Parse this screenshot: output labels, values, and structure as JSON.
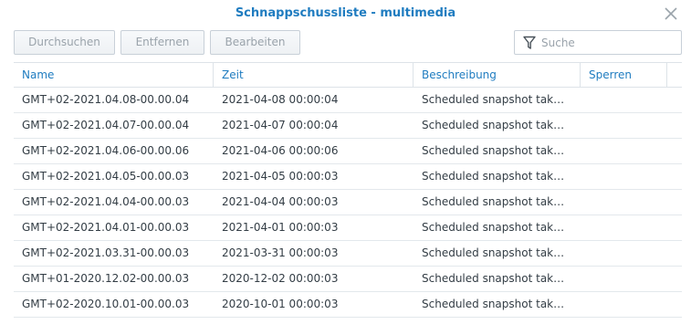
{
  "window": {
    "title": "Schnappschussliste - multimedia"
  },
  "toolbar": {
    "browse_label": "Durchsuchen",
    "remove_label": "Entfernen",
    "edit_label": "Bearbeiten",
    "search_placeholder": "Suche"
  },
  "table": {
    "columns": [
      "Name",
      "Zeit",
      "Beschreibung",
      "Sperren"
    ],
    "rows": [
      {
        "name": "GMT+02-2021.04.08-00.00.04",
        "time": "2021-04-08 00:00:04",
        "desc": "Scheduled snapshot tak…",
        "lock": ""
      },
      {
        "name": "GMT+02-2021.04.07-00.00.04",
        "time": "2021-04-07 00:00:04",
        "desc": "Scheduled snapshot tak…",
        "lock": ""
      },
      {
        "name": "GMT+02-2021.04.06-00.00.06",
        "time": "2021-04-06 00:00:06",
        "desc": "Scheduled snapshot tak…",
        "lock": ""
      },
      {
        "name": "GMT+02-2021.04.05-00.00.03",
        "time": "2021-04-05 00:00:03",
        "desc": "Scheduled snapshot tak…",
        "lock": ""
      },
      {
        "name": "GMT+02-2021.04.04-00.00.03",
        "time": "2021-04-04 00:00:03",
        "desc": "Scheduled snapshot tak…",
        "lock": ""
      },
      {
        "name": "GMT+02-2021.04.01-00.00.03",
        "time": "2021-04-01 00:00:03",
        "desc": "Scheduled snapshot tak…",
        "lock": ""
      },
      {
        "name": "GMT+02-2021.03.31-00.00.03",
        "time": "2021-03-31 00:00:03",
        "desc": "Scheduled snapshot tak…",
        "lock": ""
      },
      {
        "name": "GMT+01-2020.12.02-00.00.03",
        "time": "2020-12-02 00:00:03",
        "desc": "Scheduled snapshot tak…",
        "lock": ""
      },
      {
        "name": "GMT+02-2020.10.01-00.00.03",
        "time": "2020-10-01 00:00:03",
        "desc": "Scheduled snapshot tak…",
        "lock": ""
      }
    ]
  },
  "icons": {
    "close": "close-icon",
    "filter": "filter-icon"
  },
  "colors": {
    "accent": "#1f7cc0",
    "text": "#333d45",
    "disabled_text": "#9aa3ab",
    "border": "#dde3e8"
  }
}
